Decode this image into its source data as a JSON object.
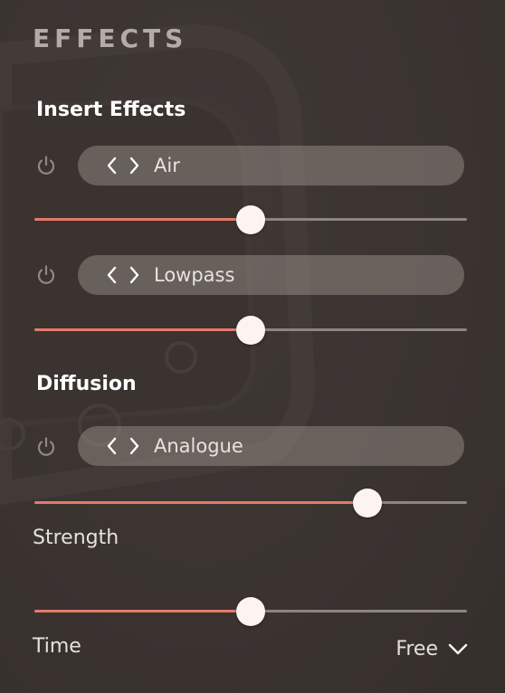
{
  "header": {
    "title": "EFFECTS"
  },
  "insert_effects": {
    "section_title": "Insert Effects",
    "slots": [
      {
        "name": "Air",
        "power_icon": "power-icon",
        "value": 0.5
      },
      {
        "name": "Lowpass",
        "power_icon": "power-icon",
        "value": 0.5
      }
    ]
  },
  "diffusion": {
    "section_title": "Diffusion",
    "effect": {
      "name": "Analogue",
      "power_icon": "power-icon",
      "value": 0.77
    },
    "strength": {
      "label": "Strength",
      "value": 0.5
    },
    "time": {
      "label": "Time",
      "mode": "Free",
      "dropdown_icon": "chevron-down-icon"
    }
  },
  "colors": {
    "accent": "#e57a6a",
    "track": "#8c8582",
    "thumb": "#fbf4f0",
    "background": "#3c3532",
    "pill": "#6e6460",
    "title": "#b3aba7"
  }
}
